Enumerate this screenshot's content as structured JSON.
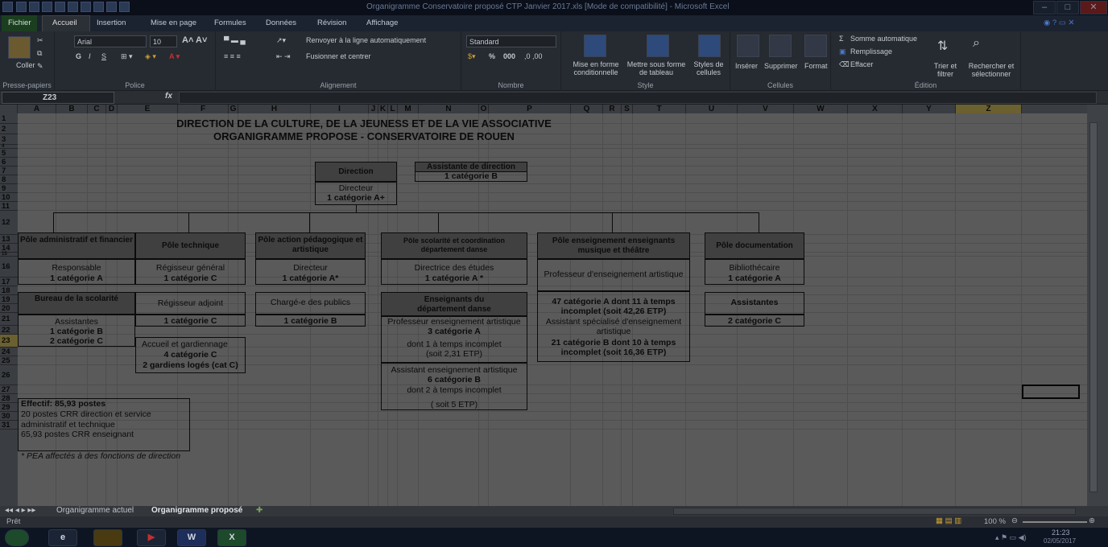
{
  "window": {
    "title": "Organigramme Conservatoire proposé CTP Janvier 2017.xls  [Mode de compatibilité] - Microsoft Excel",
    "controls": [
      "–",
      "□",
      "✕"
    ]
  },
  "menu": {
    "tabs": [
      "Fichier",
      "Accueil",
      "Insertion",
      "Mise en page",
      "Formules",
      "Données",
      "Révision",
      "Affichage"
    ]
  },
  "ribbon": {
    "clipboard": {
      "paste": "Coller",
      "group": "Presse-papiers"
    },
    "font": {
      "name": "Arial",
      "size": "10",
      "bold": "G",
      "italic": "I",
      "underline": "S",
      "group": "Police"
    },
    "alignment": {
      "wrap": "Renvoyer à la ligne automatiquement",
      "merge": "Fusionner et centrer",
      "group": "Alignement"
    },
    "number": {
      "format": "Standard",
      "percent": "%",
      "thousands": "000",
      "group": "Nombre"
    },
    "style": {
      "cond": "Mise en forme conditionnelle",
      "table": "Mettre sous forme de tableau",
      "cellstyles": "Styles de cellules",
      "group": "Style"
    },
    "cells": {
      "insert": "Insérer",
      "delete": "Supprimer",
      "format": "Format",
      "group": "Cellules"
    },
    "editing": {
      "autosum": "Somme automatique",
      "fill": "Remplissage",
      "clear": "Effacer",
      "sort": "Trier et filtrer",
      "find": "Rechercher et sélectionner",
      "group": "Édition"
    }
  },
  "formula_bar": {
    "name_box": "Z23",
    "fx": "fx",
    "value": ""
  },
  "columns": [
    "A",
    "B",
    "C",
    "D",
    "E",
    "F",
    "G",
    "H",
    "I",
    "J",
    "K",
    "L",
    "M",
    "N",
    "O",
    "P",
    "Q",
    "R",
    "S",
    "T",
    "U",
    "V",
    "W",
    "X",
    "Y",
    "Z"
  ],
  "rows": [
    "1",
    "2",
    "3",
    "4",
    "5",
    "6",
    "7",
    "8",
    "9",
    "10",
    "11",
    "12",
    "13",
    "14",
    "15",
    "16",
    "17",
    "18",
    "19",
    "20",
    "21",
    "22",
    "23",
    "24",
    "25",
    "26",
    "27",
    "28",
    "29",
    "30",
    "31"
  ],
  "sheet": {
    "title1": "DIRECTION DE LA CULTURE, DE LA JEUNESS ET DE LA VIE ASSOCIATIVE",
    "title2": "ORGANIGRAMME PROPOSE - CONSERVATOIRE DE ROUEN",
    "direction": {
      "header": "Direction",
      "role": "Directeur",
      "cat": "1 catégorie A+"
    },
    "assistante": {
      "header": "Assistante de direction",
      "cat": "1 catégorie B"
    },
    "poles": {
      "admin": {
        "header": "Pôle administratif et financier",
        "role": "Responsable",
        "cat": "1 catégorie A",
        "sub_header": "Bureau de la scolarité",
        "sub_role": "Assistantes",
        "sub_cat1": "1 catégorie B",
        "sub_cat2": "2 catégorie C"
      },
      "tech": {
        "header": "Pôle technique",
        "role": "Régisseur général",
        "cat": "1 catégorie C",
        "role2": "Régisseur adjoint",
        "cat2": "1 catégorie C",
        "role3": "Accueil et gardiennage",
        "cat3": "4 catégorie C",
        "cat3b": "2 gardiens logés (cat C)"
      },
      "peda": {
        "header": "Pôle action pédagogique et artistique",
        "role": "Directeur",
        "cat": "1 catégorie A*",
        "role2": "Chargé-e des publics",
        "cat2": "1 catégorie B"
      },
      "scol": {
        "header": "Pôle scolarité et coordination département danse",
        "role": "Directrice des études",
        "cat": "1 catégorie A *",
        "sub_header": "Enseignants du département danse",
        "pea": "Professeur enseignement artistique",
        "pea_cat": "3 catégorie A",
        "pea_note": "dont 1 à temps incomplet",
        "pea_etp": "(soit 2,31 ETP)",
        "aea": "Assistant enseignement artistique",
        "aea_cat": "6 catégorie B",
        "aea_note": "dont 2 à temps incomplet",
        "aea_etp": "( soit 5 ETP)"
      },
      "ens": {
        "header": "Pôle enseignement enseignants musique et théâtre",
        "role": "Professeur d'enseignement artistique",
        "cat": "47 catégorie A dont 11 à temps incomplet (soit 42,26 ETP)",
        "role2": "Assistant spécialisé d'enseignement artistique",
        "cat2": "21 catégorie B dont 10 à temps incomplet (soit 16,36 ETP)"
      },
      "doc": {
        "header": "Pôle documentation",
        "role": "Bibliothécaire",
        "cat": "1 catégorie A",
        "role2": "Assistantes",
        "cat2": "2 catégorie C"
      }
    },
    "effectif": {
      "line1": "Effectif: 85,93 postes",
      "line2": "20 postes CRR direction et service",
      "line3": "administratif et technique",
      "line4": "65,93 postes CRR enseignant"
    },
    "note": "* PEA affectés à des fonctions de direction"
  },
  "sheet_tabs": [
    "Organigramme actuel",
    "Organigramme proposé"
  ],
  "status": {
    "ready": "Prêt",
    "zoom": "100 %"
  },
  "clock": {
    "time": "21:23",
    "date": "02/05/2017"
  }
}
